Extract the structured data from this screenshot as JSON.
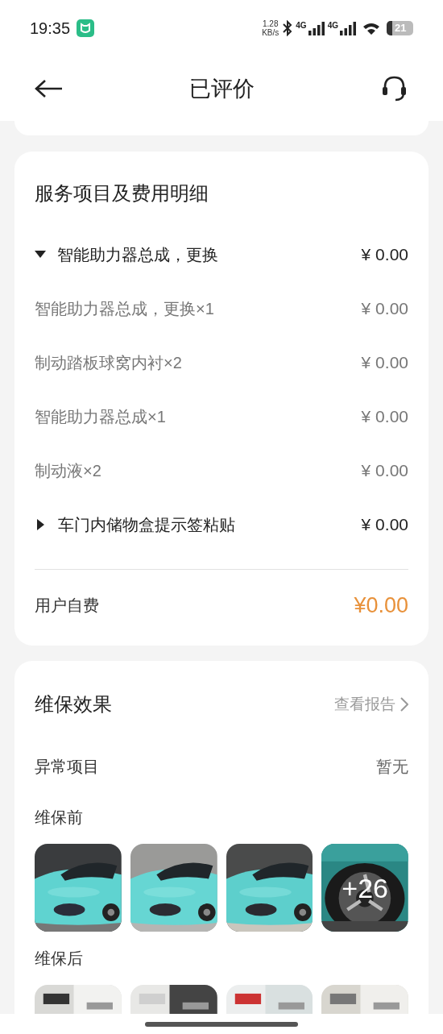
{
  "status_bar": {
    "time": "19:35",
    "speed_value": "1.28",
    "speed_unit": "KB/s",
    "networks": [
      "4G",
      "4G"
    ],
    "battery": "21"
  },
  "header": {
    "title": "已评价"
  },
  "services": {
    "title": "服务项目及费用明细",
    "groups": [
      {
        "name": "智能助力器总成，更换",
        "price": "¥ 0.00",
        "expanded": true,
        "children": [
          {
            "name": "智能助力器总成，更换×1",
            "price": "¥ 0.00"
          },
          {
            "name": "制动踏板球窝内衬×2",
            "price": "¥ 0.00"
          },
          {
            "name": "智能助力器总成×1",
            "price": "¥ 0.00"
          },
          {
            "name": "制动液×2",
            "price": "¥ 0.00"
          }
        ]
      },
      {
        "name": "车门内储物盒提示签粘贴",
        "price": "¥ 0.00",
        "expanded": false
      }
    ],
    "total_label": "用户自费",
    "total": "¥0.00"
  },
  "maintenance": {
    "title": "维保效果",
    "report_link": "查看报告",
    "abnormal_label": "异常项目",
    "abnormal_value": "暂无",
    "before": {
      "label": "维保前",
      "photos": [
        {
          "kind": "picture"
        },
        {
          "kind": "picture"
        },
        {
          "kind": "picture"
        },
        {
          "kind": "picture",
          "overlay": "+26"
        }
      ]
    },
    "after": {
      "label": "维保后",
      "photos": [
        {
          "kind": "picture"
        },
        {
          "kind": "picture"
        },
        {
          "kind": "picture"
        },
        {
          "kind": "picture"
        }
      ]
    }
  }
}
